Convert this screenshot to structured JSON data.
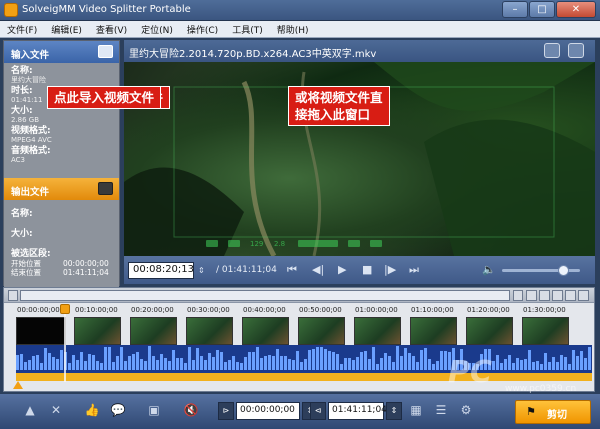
{
  "app": {
    "title": "SolveigMM Video Splitter Portable",
    "window_buttons": [
      "–",
      "□",
      "✕"
    ]
  },
  "menu": [
    "文件(F)",
    "编辑(E)",
    "查看(V)",
    "定位(N)",
    "操作(C)",
    "工具(T)",
    "帮助(H)"
  ],
  "input_panel": {
    "header": "输入文件",
    "name_label": "名称:",
    "name_value": "里约大冒险",
    "duration_label": "时长:",
    "duration_value": "01:41:11",
    "size_label": "大小:",
    "size_value": "2.86 GB",
    "video_format_label": "视频格式:",
    "video_format_value": "MPEG4 AVC",
    "audio_format_label": "音频格式:",
    "audio_format_value": "AC3"
  },
  "output_panel": {
    "header": "输出文件",
    "name_label": "名称:",
    "size_label": "大小:",
    "marked_label": "被选区段:",
    "start_label": "开始位置",
    "start_value": "00:00:00;00",
    "end_label": "结束位置",
    "end_value": "01:41:11;04"
  },
  "video": {
    "filename": "里约大冒险2.2014.720p.BD.x264.AC3中英双字.mkv",
    "hud_numbers": [
      "129",
      "2.8"
    ]
  },
  "annotations": {
    "left_callout": "点此导入视频文件",
    "right_callout_line1": "或将视频文件直",
    "right_callout_line2": "接拖入此窗口"
  },
  "controls": {
    "current_time": "00:08:20;13",
    "duration": "/ 01:41:11;04",
    "volume_fraction": 0.78
  },
  "timeline": {
    "ticks": [
      "00:00:00;00",
      "00:10:00;00",
      "00:20:00;00",
      "00:30:00;00",
      "00:40:00;00",
      "00:50:00;00",
      "01:00:00;00",
      "01:10:00;00",
      "01:20:00;00",
      "01:30:00;00"
    ]
  },
  "bottom_bar": {
    "start_time": "00:00:00;00",
    "end_time": "01:41:11;04",
    "cut_label": "剪切"
  },
  "watermark": {
    "text": "PC",
    "url": "www.pc0359.cn"
  },
  "colors": {
    "callout": "#d81d14",
    "accent_orange": "#f2a014",
    "waveform": "#1a3a8c"
  }
}
